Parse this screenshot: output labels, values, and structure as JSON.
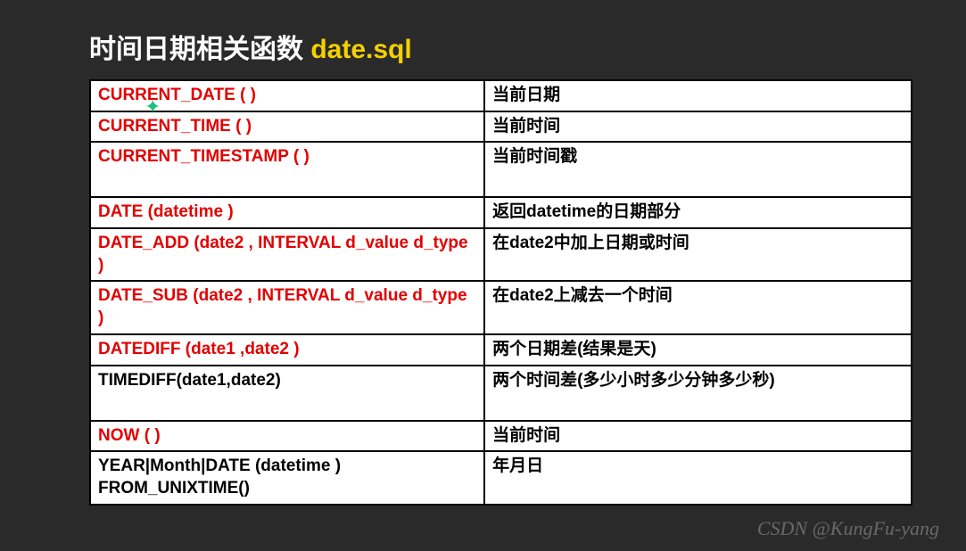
{
  "title_part1": "时间日期相关函数 ",
  "title_part2": "date.sql",
  "rows": [
    {
      "fn": "CURRENT_DATE (   )",
      "fn_red": true,
      "desc": "当前日期",
      "tall": false
    },
    {
      "fn": "CURRENT_TIME (   )",
      "fn_red": true,
      "desc": "当前时间",
      "tall": false
    },
    {
      "fn": "CURRENT_TIMESTAMP (  )",
      "fn_red": true,
      "desc": "当前时间戳",
      "tall": true
    },
    {
      "fn": "DATE (datetime )",
      "fn_red": true,
      "desc_html": "返回<b>datetime</b>的日期部分",
      "tall": false
    },
    {
      "fn": "DATE_ADD (date2 , INTERVAL d_value d_type )",
      "fn_red": true,
      "desc_html": "在<b>date2</b>中加上日期或时间",
      "tall": false
    },
    {
      "fn": "DATE_SUB (date2 , INTERVAL d_value d_type )",
      "fn_red": true,
      "desc_html": "在<b>date2</b>上减去一个时间",
      "tall": false
    },
    {
      "fn": "DATEDIFF (date1 ,date2 )",
      "fn_red": true,
      "desc_html": "两个日期差<b>(</b>结果是天<b>)</b>",
      "tall": false
    },
    {
      "fn": "TIMEDIFF(date1,date2)",
      "fn_red": false,
      "desc": "两个时间差(多少小时多少分钟多少秒)",
      "tall": true
    },
    {
      "fn": "NOW (   )",
      "fn_red": true,
      "desc": "当前时间",
      "tall": false
    },
    {
      "fn": "YEAR|Month|DATE (datetime )\nFROM_UNIXTIME()",
      "fn_red": false,
      "desc": "年月日",
      "tall": false
    }
  ],
  "watermark": "CSDN @KungFu-yang"
}
